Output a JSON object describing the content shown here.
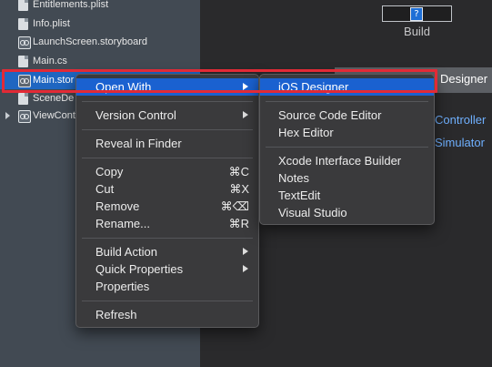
{
  "solution_pad": {
    "files": [
      {
        "name": "Entitlements.plist",
        "icon": "plist-file-icon"
      },
      {
        "name": "Info.plist",
        "icon": "plist-file-icon"
      },
      {
        "name": "LaunchScreen.storyboard",
        "icon": "storyboard-file-icon"
      },
      {
        "name": "Main.cs",
        "icon": "cs-file-icon"
      },
      {
        "name": "Main.stor",
        "icon": "storyboard-file-icon",
        "selected": true
      },
      {
        "name": "SceneDe",
        "icon": "cs-file-icon"
      },
      {
        "name": "ViewCont",
        "icon": "folder-icon",
        "collapsed": true
      }
    ]
  },
  "canvas": {
    "build_label": "Build",
    "build_glyph": "?",
    "designer_label": "Designer",
    "controller_link": "Controller",
    "simulator_link": "Simulator"
  },
  "context_menu": {
    "open_with": "Open With",
    "version_control": "Version Control",
    "reveal_in_finder": "Reveal in Finder",
    "copy": {
      "label": "Copy",
      "shortcut": "⌘C"
    },
    "cut": {
      "label": "Cut",
      "shortcut": "⌘X"
    },
    "remove": {
      "label": "Remove",
      "shortcut": "⌘⌫"
    },
    "rename": {
      "label": "Rename...",
      "shortcut": "⌘R"
    },
    "build_action": "Build Action",
    "quick_properties": "Quick Properties",
    "properties": "Properties",
    "refresh": "Refresh"
  },
  "open_with_submenu": {
    "ios_designer": "iOS Designer",
    "source_code_editor": "Source Code Editor",
    "hex_editor": "Hex Editor",
    "xcode_interface_builder": "Xcode Interface Builder",
    "notes": "Notes",
    "textedit": "TextEdit",
    "visual_studio": "Visual Studio"
  },
  "colors": {
    "highlight": "#1a61d0",
    "selection": "#1f66c1",
    "annotation_outline": "#e22a36",
    "link": "#6fb0ff"
  }
}
